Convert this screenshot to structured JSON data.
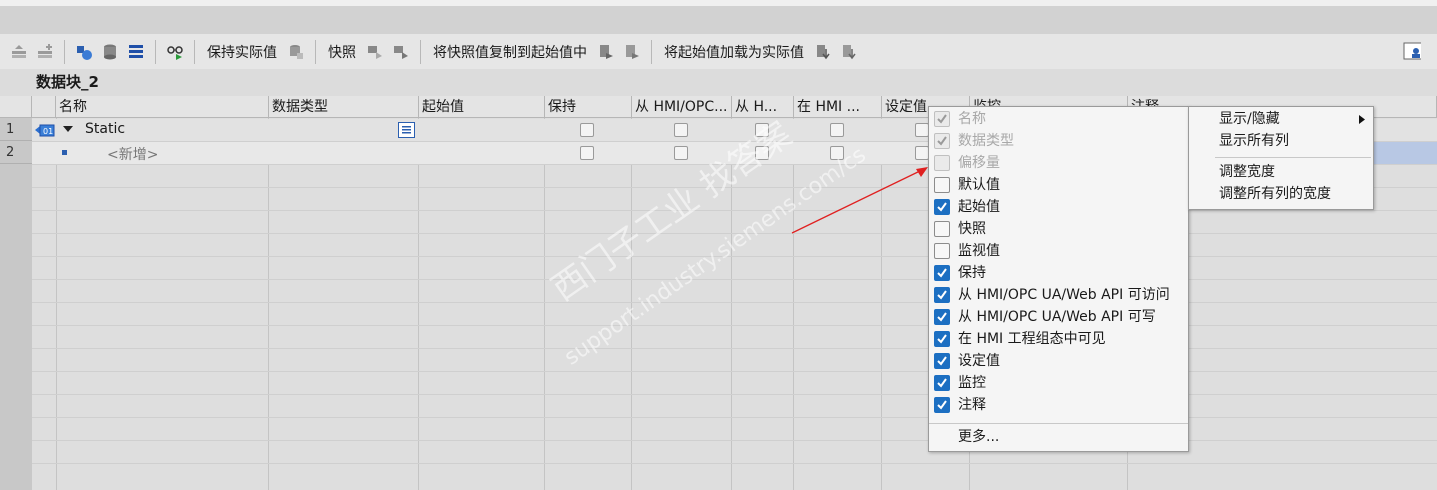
{
  "toolbar": {
    "keep_actual_label": "保持实际值",
    "snapshot_label": "快照",
    "copy_snapshot_label": "将快照值复制到起始值中",
    "load_start_label": "将起始值加载为实际值"
  },
  "block": {
    "title": "数据块_2"
  },
  "columns": [
    {
      "key": "name",
      "label": "名称"
    },
    {
      "key": "datatype",
      "label": "数据类型"
    },
    {
      "key": "start",
      "label": "起始值"
    },
    {
      "key": "retain",
      "label": "保持"
    },
    {
      "key": "hmi_access",
      "label": "从 HMI/OPC..."
    },
    {
      "key": "hmi_write",
      "label": "从 H..."
    },
    {
      "key": "hmi_visible",
      "label": "在 HMI ..."
    },
    {
      "key": "setpoint",
      "label": "设定值"
    },
    {
      "key": "monitor",
      "label": "监控"
    },
    {
      "key": "comment",
      "label": "注释"
    }
  ],
  "rows": [
    {
      "num": "1",
      "name": "Static"
    },
    {
      "num": "2",
      "name": "<新增>"
    }
  ],
  "context_menu": {
    "items": [
      {
        "label": "名称",
        "state": "disabled-checked"
      },
      {
        "label": "数据类型",
        "state": "disabled-checked"
      },
      {
        "label": "偏移量",
        "state": "disabled"
      },
      {
        "label": "默认值",
        "state": "off"
      },
      {
        "label": "起始值",
        "state": "on"
      },
      {
        "label": "快照",
        "state": "off"
      },
      {
        "label": "监视值",
        "state": "off"
      },
      {
        "label": "保持",
        "state": "on"
      },
      {
        "label": "从 HMI/OPC UA/Web API 可访问",
        "state": "on"
      },
      {
        "label": "从 HMI/OPC UA/Web API 可写",
        "state": "on"
      },
      {
        "label": "在 HMI 工程组态中可见",
        "state": "on"
      },
      {
        "label": "设定值",
        "state": "on"
      },
      {
        "label": "监控",
        "state": "on"
      },
      {
        "label": "注释",
        "state": "on"
      }
    ],
    "more_label": "更多..."
  },
  "header_menu": {
    "show_hide": "显示/隐藏",
    "show_all": "显示所有列",
    "adjust_width": "调整宽度",
    "adjust_all_width": "调整所有列的宽度"
  },
  "watermark": {
    "line1": "西门子工业   找答案",
    "line2": "support.industry.siemens.com/cs"
  },
  "colors": {
    "accent": "#1c6fc2",
    "arrow": "#e02020"
  }
}
